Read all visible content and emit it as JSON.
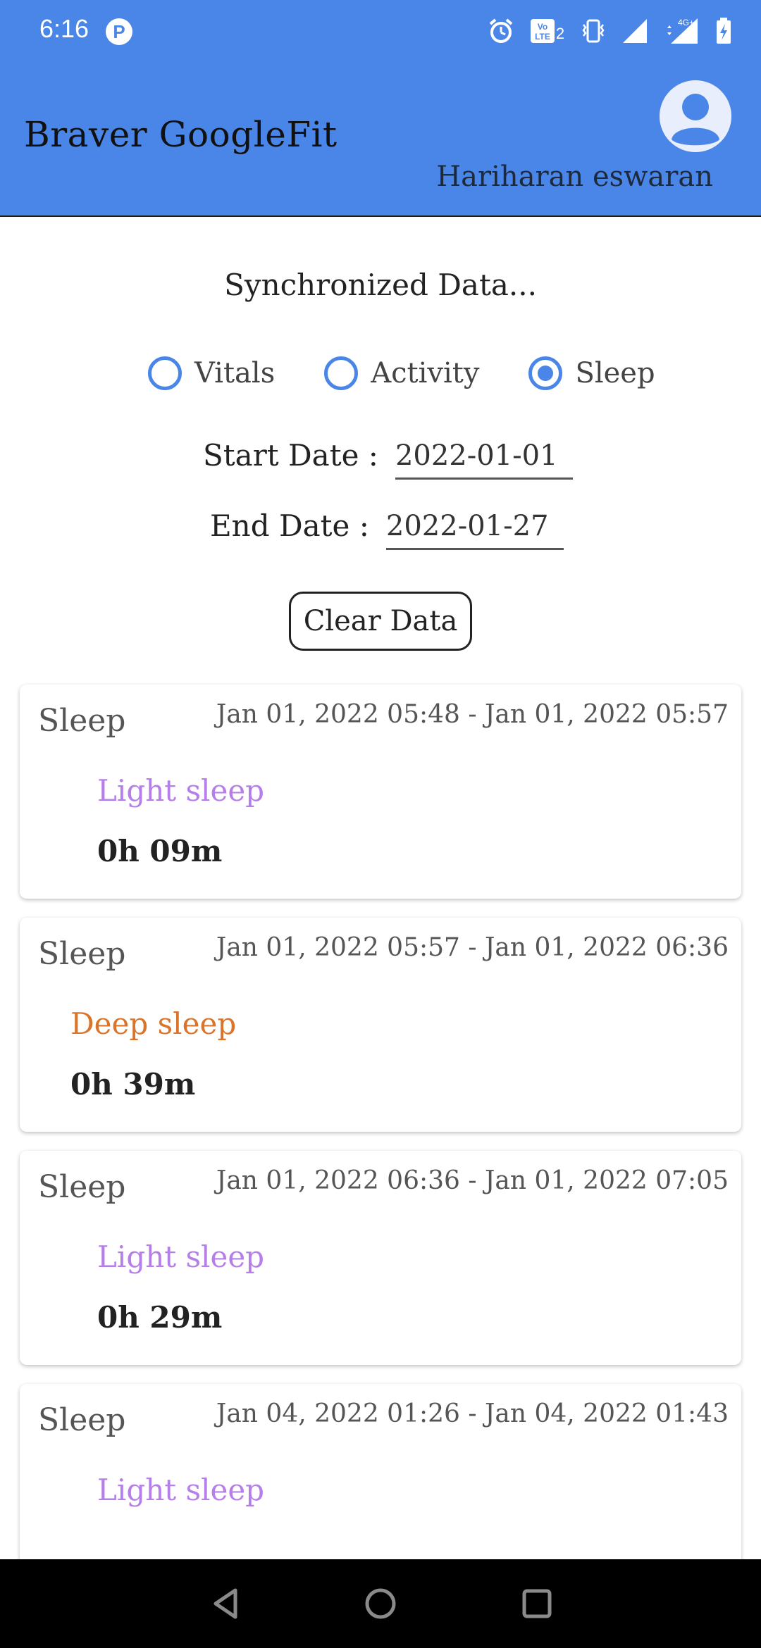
{
  "status_bar": {
    "time": "6:16",
    "app_badge": "P",
    "icons": [
      "alarm-icon",
      "volte-icon",
      "vibrate-icon",
      "signal-icon",
      "4g-signal-icon",
      "battery-icon"
    ],
    "network_label": "4G+"
  },
  "header": {
    "title": "Braver GoogleFit",
    "user_name": "Hariharan eswaran",
    "background_color": "#4a86e8"
  },
  "content": {
    "sync_title": "Synchronized Data...",
    "radio_options": [
      {
        "label": "Vitals",
        "checked": false
      },
      {
        "label": "Activity",
        "checked": false
      },
      {
        "label": "Sleep",
        "checked": true
      }
    ],
    "start_date": {
      "label": "Start Date :",
      "value": "2022-01-01"
    },
    "end_date": {
      "label": "End Date :",
      "value": "2022-01-27"
    },
    "clear_button": "Clear Data"
  },
  "cards": [
    {
      "type": "Sleep",
      "range": "Jan 01, 2022 05:48 - Jan 01, 2022 05:57",
      "stage": "Light sleep",
      "stage_color": "#b57ee8",
      "duration": "0h 09m"
    },
    {
      "type": "Sleep",
      "range": "Jan 01, 2022 05:57 - Jan 01, 2022 06:36",
      "stage": "Deep sleep",
      "stage_color": "#d9742a",
      "duration": "0h 39m"
    },
    {
      "type": "Sleep",
      "range": "Jan 01, 2022 06:36 - Jan 01, 2022 07:05",
      "stage": "Light sleep",
      "stage_color": "#b57ee8",
      "duration": "0h 29m"
    },
    {
      "type": "Sleep",
      "range": "Jan 04, 2022 01:26 - Jan 04, 2022 01:43",
      "stage": "Light sleep",
      "stage_color": "#b57ee8",
      "duration": ""
    }
  ],
  "nav_bar": {
    "icons": [
      "back-icon",
      "home-icon",
      "recents-icon"
    ]
  }
}
